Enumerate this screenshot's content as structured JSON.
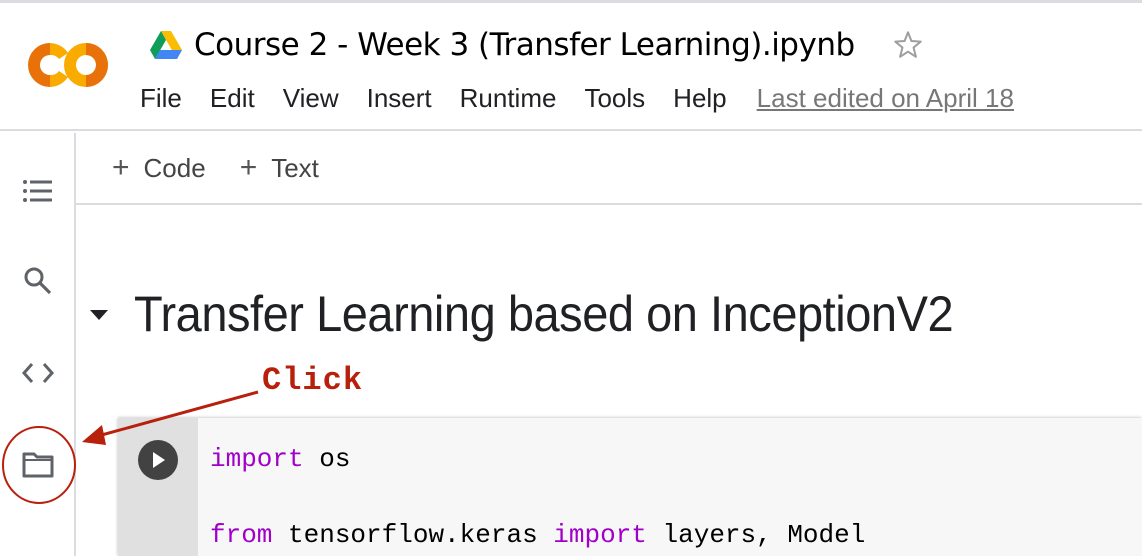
{
  "header": {
    "title": "Course 2 - Week 3 (Transfer Learning).ipynb",
    "star_icon": "star-outline-icon",
    "menu": [
      "File",
      "Edit",
      "View",
      "Insert",
      "Runtime",
      "Tools",
      "Help"
    ],
    "last_edited": "Last edited on April 18"
  },
  "rail": {
    "items": [
      {
        "icon": "table-of-contents-icon"
      },
      {
        "icon": "search-icon"
      },
      {
        "icon": "code-snippets-icon"
      },
      {
        "icon": "folder-icon"
      }
    ]
  },
  "toolbar": {
    "add_code_label": "Code",
    "add_text_label": "Text"
  },
  "notebook": {
    "heading": "Transfer Learning based on InceptionV2",
    "cell": {
      "lines": [
        {
          "keyword": "import",
          "rest": " os"
        },
        {
          "keyword": "",
          "rest": ""
        },
        {
          "keyword": "from",
          "rest": " tensorflow.keras ",
          "keyword2": "import",
          "rest2": " layers, Model"
        }
      ]
    }
  },
  "annotation": {
    "label": "Click",
    "color": "#b8200c"
  },
  "colors": {
    "code_keyword": "#a000c8",
    "logo_orange": "#e8710a",
    "logo_yellow": "#f9ab00"
  }
}
